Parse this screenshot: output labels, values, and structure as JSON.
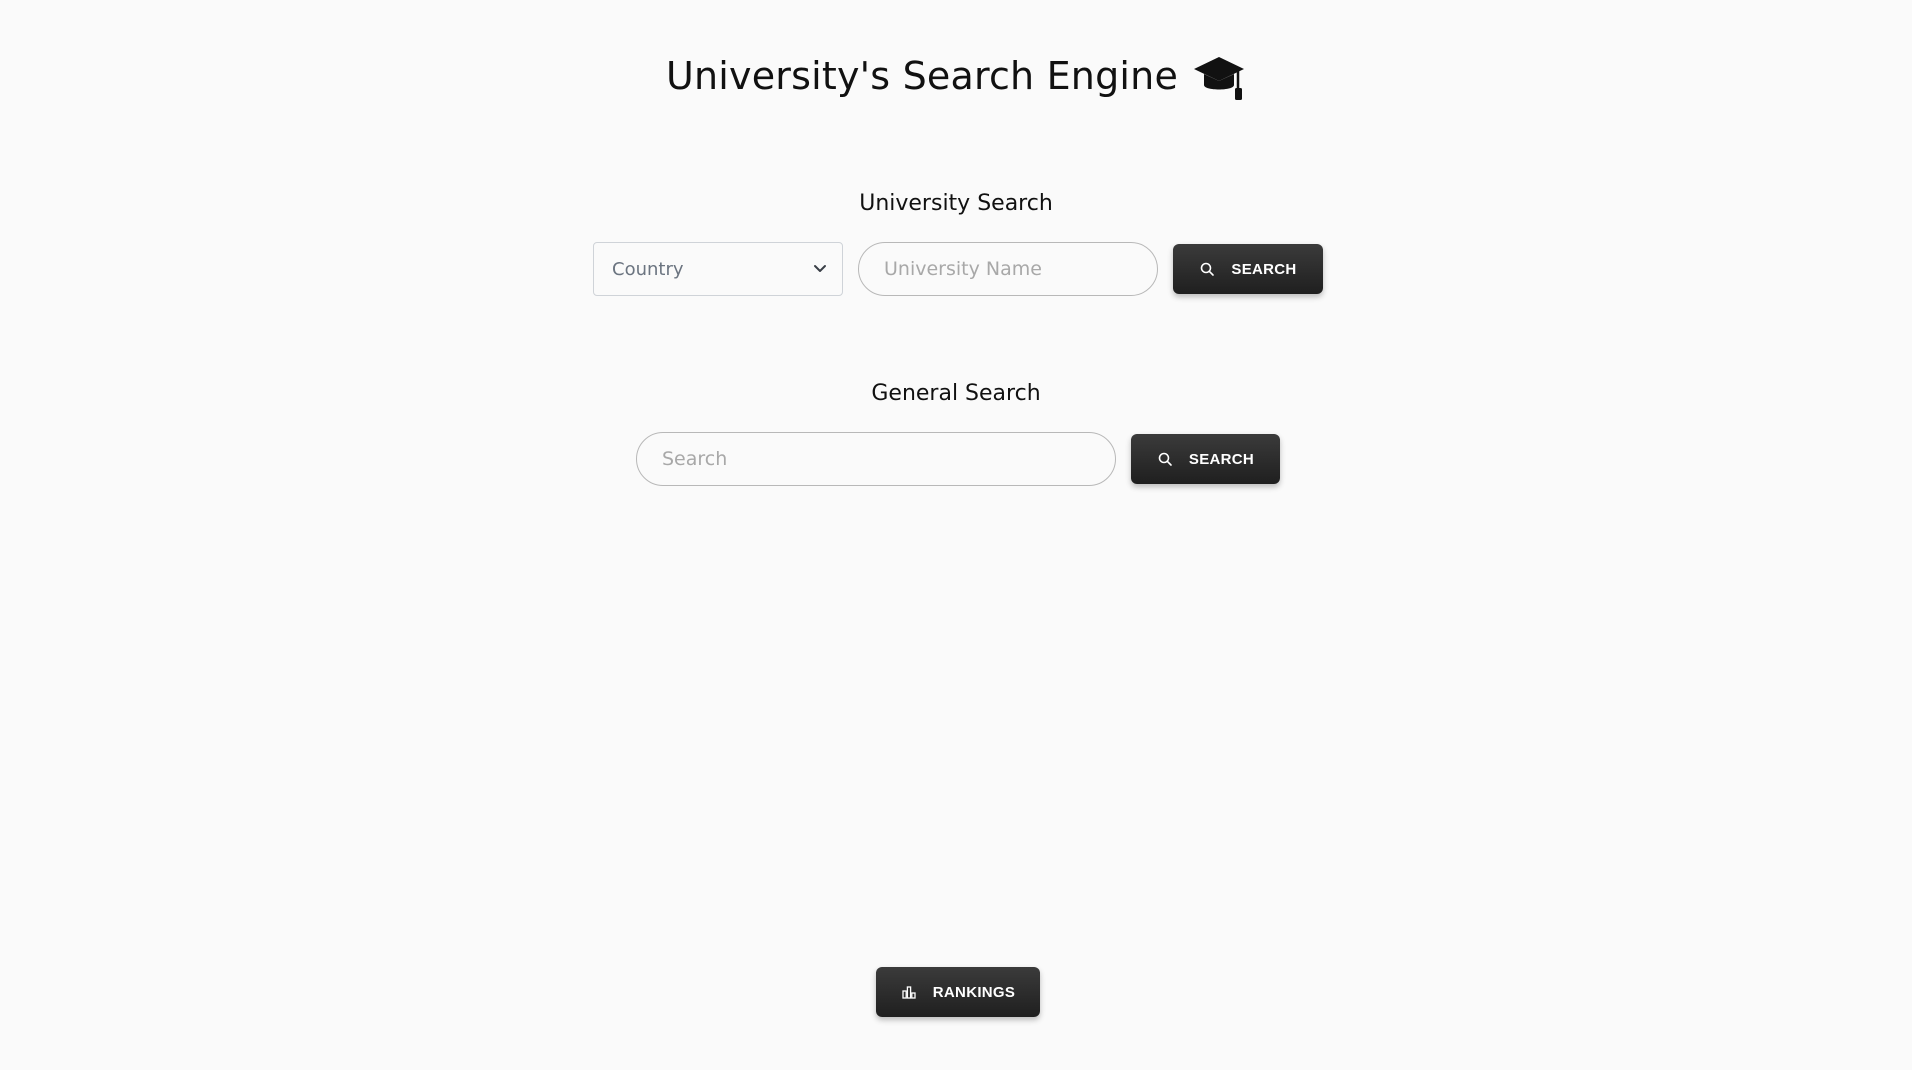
{
  "header": {
    "title": "University's Search Engine",
    "icon": "graduation-cap-icon"
  },
  "university_search": {
    "title": "University Search",
    "country_select": {
      "selected": "Country",
      "icon": "chevron-down-icon"
    },
    "name_input": {
      "value": "",
      "placeholder": "University Name"
    },
    "search_button": {
      "label": "SEARCH",
      "icon": "search-icon"
    }
  },
  "general_search": {
    "title": "General Search",
    "query_input": {
      "value": "",
      "placeholder": "Search"
    },
    "search_button": {
      "label": "SEARCH",
      "icon": "search-icon"
    }
  },
  "footer": {
    "rankings_button": {
      "label": "RANKINGS",
      "icon": "bar-chart-icon"
    }
  },
  "colors": {
    "background": "#fafafa",
    "button": "#2a2a2a",
    "button_text": "#ffffff"
  }
}
